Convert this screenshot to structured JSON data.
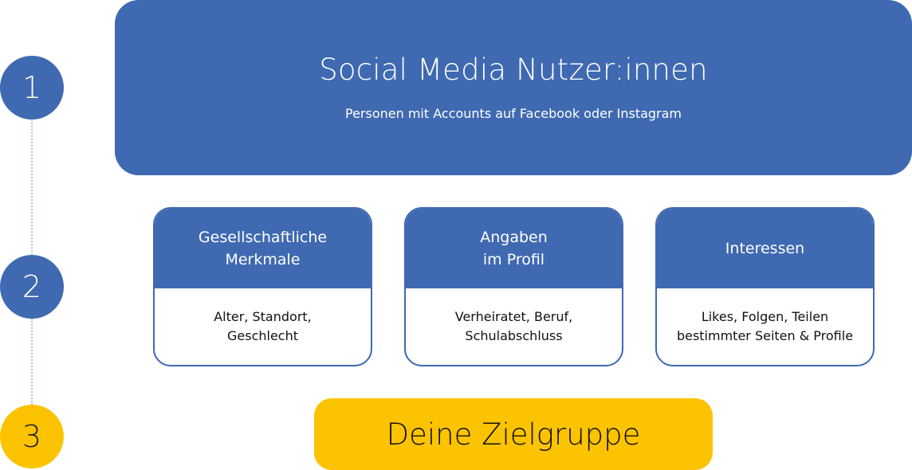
{
  "steps": [
    {
      "number": "1",
      "color": "#3f69b1"
    },
    {
      "number": "2",
      "color": "#3f69b1"
    },
    {
      "number": "3",
      "color": "#fcc300"
    }
  ],
  "level1": {
    "title": "Social Media Nutzer:innen",
    "subtitle": "Personen mit Accounts auf Facebook oder Instagram"
  },
  "cards": [
    {
      "heading": "Gesellschaftliche\nMerkmale",
      "body": "Alter, Standort,\nGeschlecht"
    },
    {
      "heading": "Angaben\nim Profil",
      "body": "Verheiratet, Beruf,\nSchulabschluss"
    },
    {
      "heading": "Interessen",
      "body": "Likes, Folgen, Teilen\nbestimmter Seiten & Profile"
    }
  ],
  "level3": {
    "label": "Deine Zielgruppe"
  },
  "colors": {
    "primary": "#3f69b1",
    "accent": "#fcc300",
    "connector": "#a9c4ee"
  }
}
